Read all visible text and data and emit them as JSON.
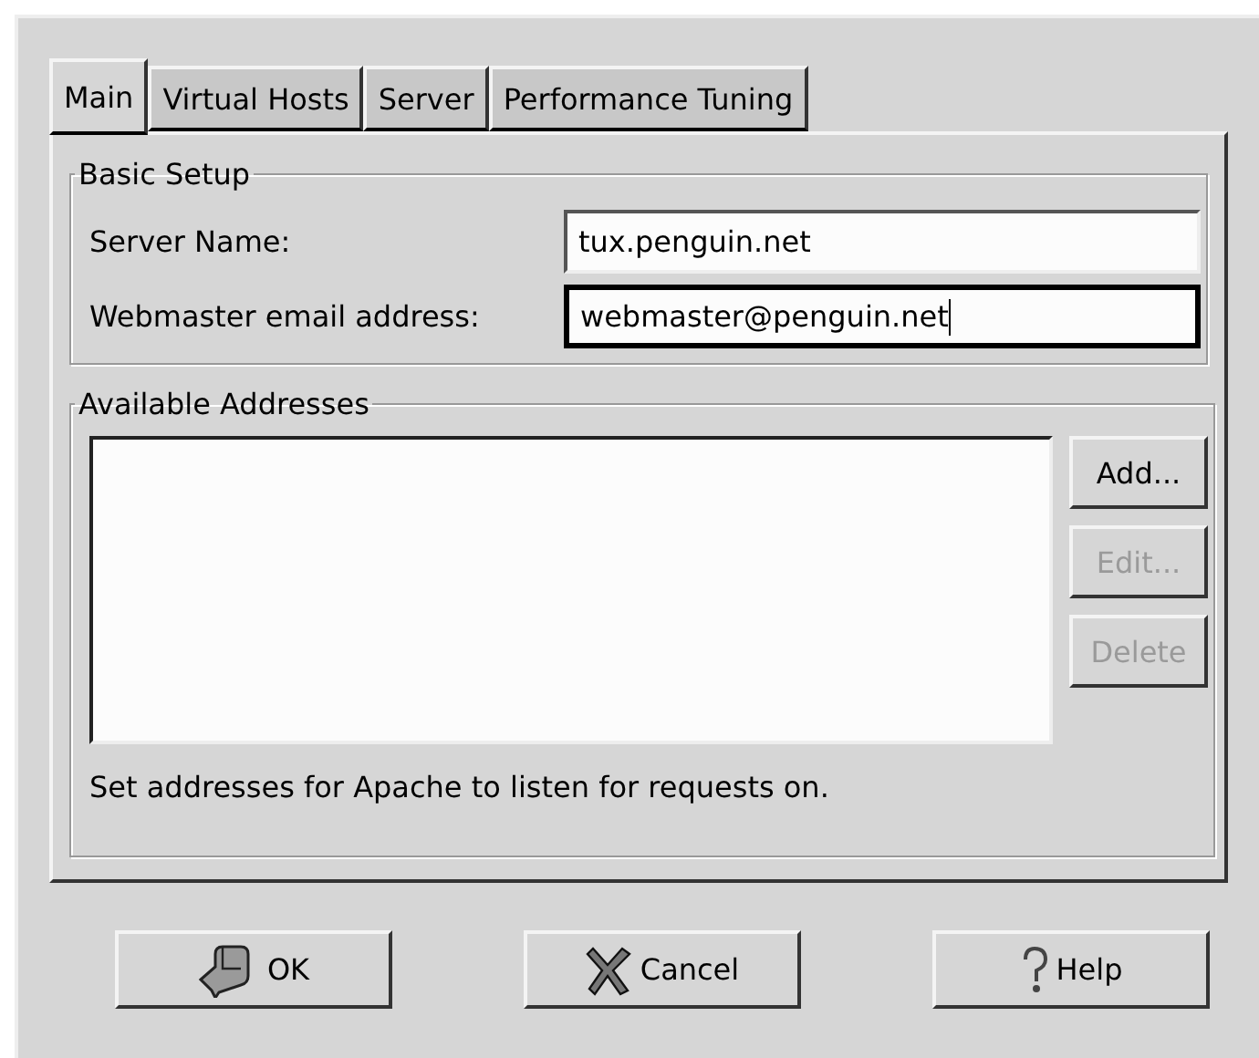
{
  "tabs": [
    {
      "label": "Main",
      "selected": true
    },
    {
      "label": "Virtual Hosts",
      "selected": false
    },
    {
      "label": "Server",
      "selected": false
    },
    {
      "label": "Performance Tuning",
      "selected": false
    }
  ],
  "basic_setup": {
    "title": "Basic Setup",
    "fields": [
      {
        "label": "Server Name:",
        "value": "tux.penguin.net",
        "focused": false
      },
      {
        "label": "Webmaster email address:",
        "value": "webmaster@penguin.net",
        "focused": true
      }
    ]
  },
  "available_addresses": {
    "title": "Available Addresses",
    "buttons": [
      {
        "label": "Add...",
        "disabled": false
      },
      {
        "label": "Edit...",
        "disabled": true
      },
      {
        "label": "Delete",
        "disabled": true
      }
    ],
    "hint": "Set addresses for Apache to listen for requests on."
  },
  "buttons": [
    {
      "kind": "ok",
      "label": "OK"
    },
    {
      "kind": "cancel",
      "label": "Cancel"
    },
    {
      "kind": "help",
      "label": "Help"
    }
  ]
}
